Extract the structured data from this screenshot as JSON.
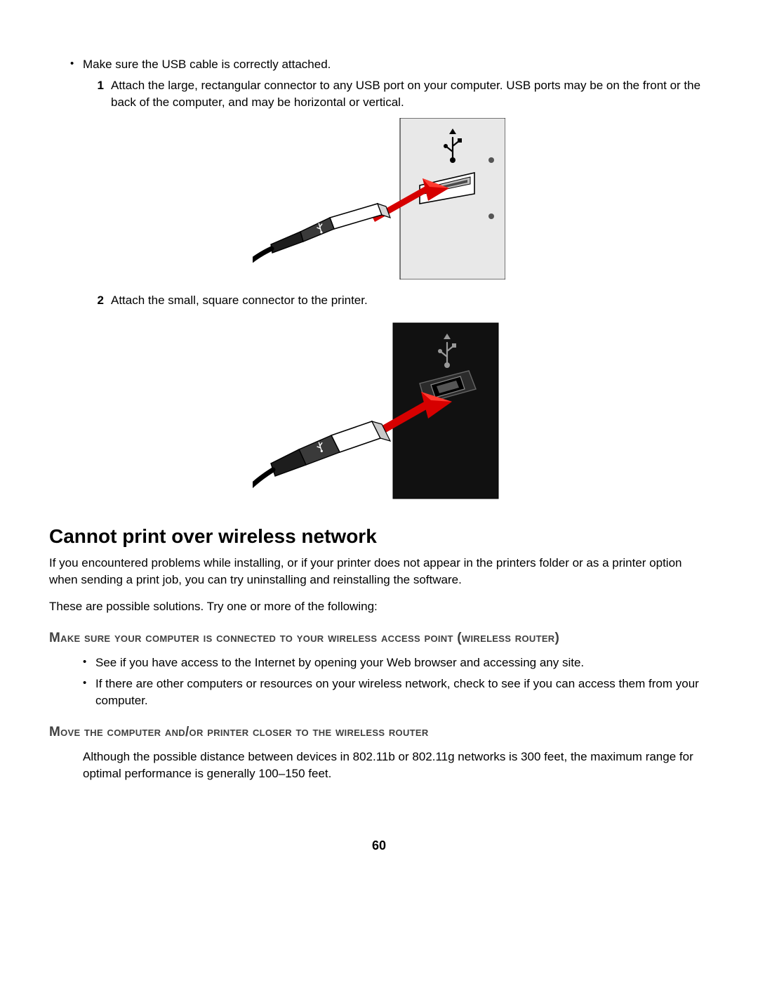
{
  "top_bullet": "Make sure the USB cable is correctly attached.",
  "steps": {
    "1": {
      "num": "1",
      "text": "Attach the large, rectangular connector to any USB port on your computer. USB ports may be on the front or the back of the computer, and may be horizontal or vertical."
    },
    "2": {
      "num": "2",
      "text": "Attach the small, square connector to the printer."
    }
  },
  "section_title": "Cannot print over wireless network",
  "section_p1": "If you encountered problems while installing, or if your printer does not appear in the printers folder or as a printer option when sending a print job, you can try uninstalling and reinstalling the software.",
  "section_p2": "These are possible solutions. Try one or more of the following:",
  "heads": {
    "h1": "Make sure your computer is connected to your wireless access point (wireless router)",
    "h2": "Move the computer and/or printer closer to the wireless router"
  },
  "h1_bullets": {
    "0": "See if you have access to the Internet by opening your Web browser and accessing any site.",
    "1": "If there are other computers or resources on your wireless network, check to see if you can access them from your computer."
  },
  "h2_para": "Although the possible distance between devices in 802.11b or 802.11g networks is 300 feet, the maximum range for optimal performance is generally 100–150 feet.",
  "page_number": "60"
}
